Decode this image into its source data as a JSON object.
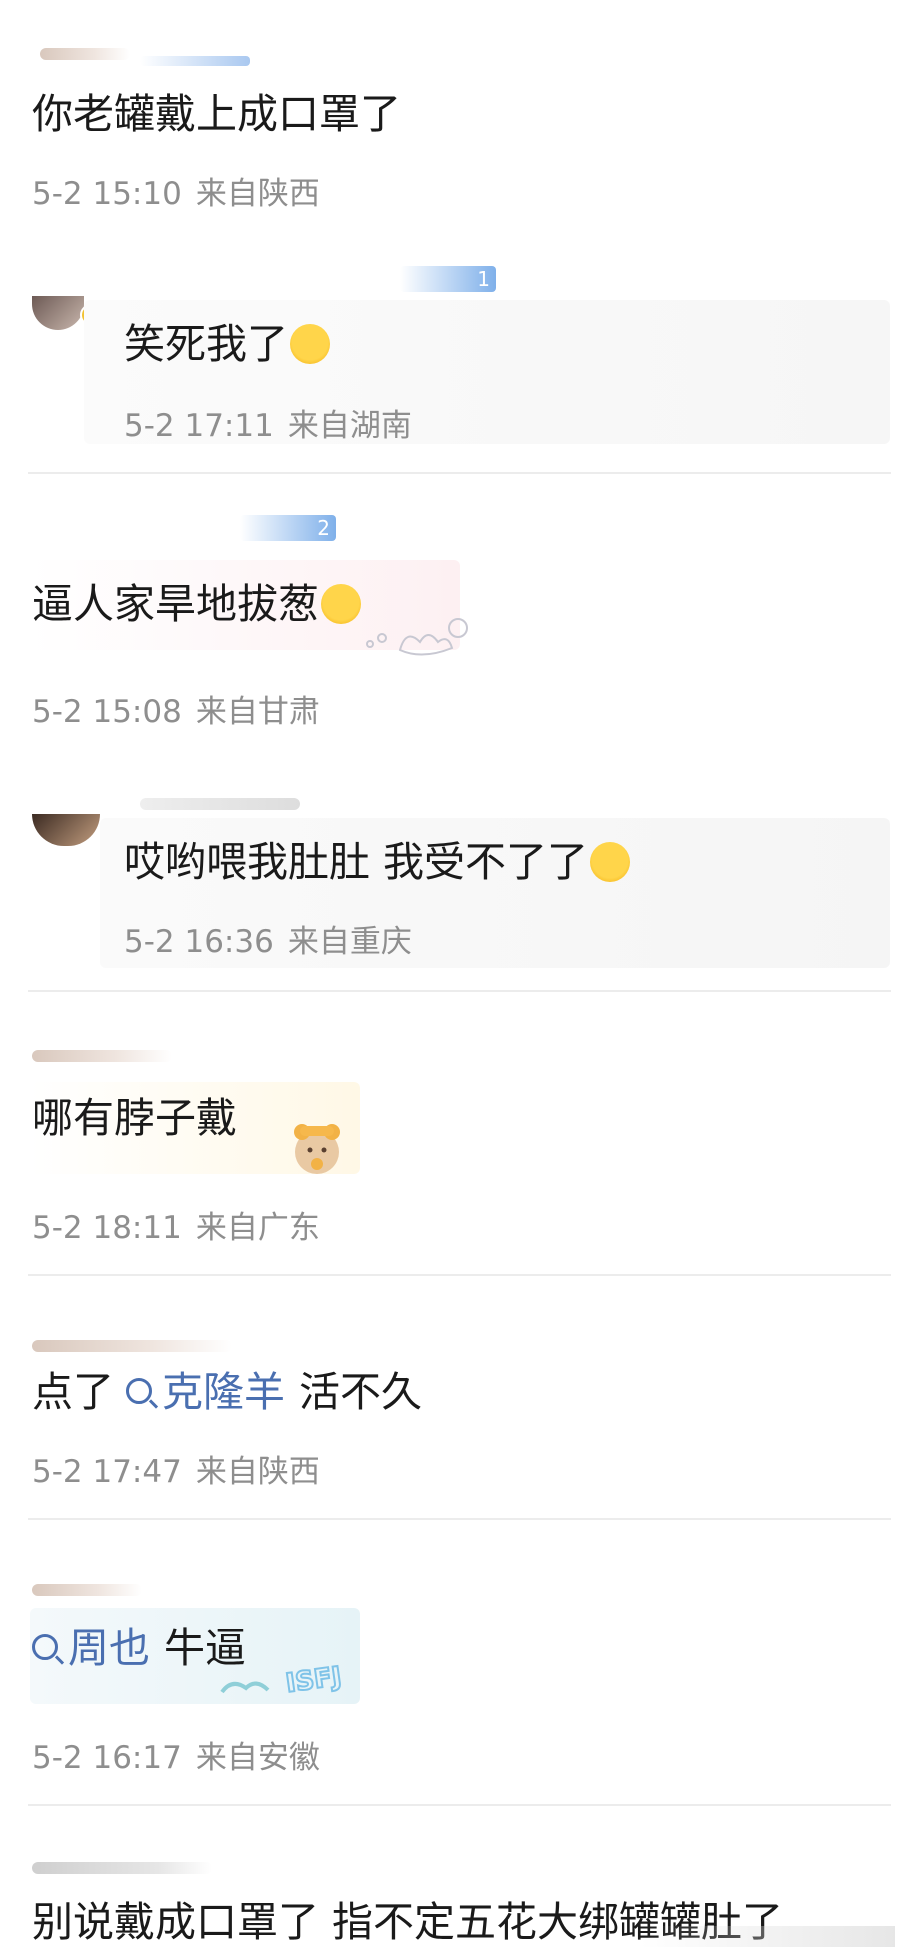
{
  "comments": [
    {
      "text": "你老罐戴上成口罩了",
      "date": "5-2 15:10",
      "location": "来自陕西"
    },
    {
      "text": "笑死我了",
      "date": "5-2 17:11",
      "location": "来自湖南",
      "emoji": "crying-laughing-emoji"
    },
    {
      "text": "逼人家旱地拔葱",
      "date": "5-2 15:08",
      "location": "来自甘肃",
      "emoji": "laughing-emoji"
    },
    {
      "text": "哎哟喂我肚肚 我受不了了",
      "date": "5-2 16:36",
      "location": "来自重庆",
      "emoji": "laughing-emoji"
    },
    {
      "text": "哪有脖子戴",
      "date": "5-2 18:11",
      "location": "来自广东"
    },
    {
      "text_prefix": "点了",
      "topic": "克隆羊",
      "text_suffix": "活不久",
      "date": "5-2 17:47",
      "location": "来自陕西"
    },
    {
      "topic": "周也",
      "text_suffix": "牛逼",
      "date": "5-2 16:17",
      "location": "来自安徽"
    },
    {
      "text": "别说戴成口罩了 指不定五花大绑罐罐肚了"
    }
  ],
  "badges": [
    "1",
    "2"
  ],
  "stickers": {
    "sticker3": "cloud-doodle-sticker",
    "sticker7": "ISFJ"
  }
}
